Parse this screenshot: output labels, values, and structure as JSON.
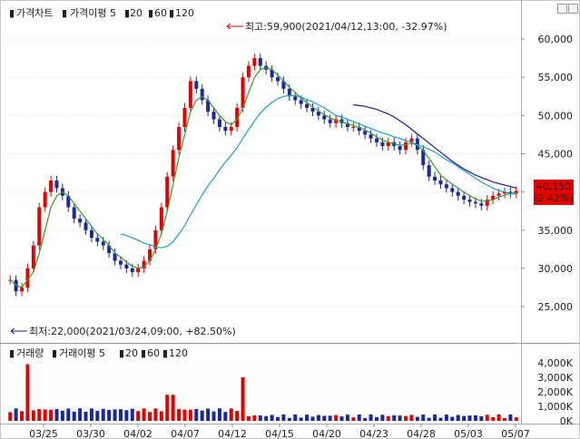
{
  "legend": {
    "price": {
      "marker": "▮",
      "label": "가격차트",
      "color": "#000000"
    },
    "ma_label": "가격이평 5",
    "ma20": "20",
    "ma60": "60",
    "ma120": "120",
    "vol": {
      "label": "거래량"
    },
    "vma_label": "거래이평 5",
    "vma20": "20",
    "vma60": "60",
    "vma120": "120",
    "colors": {
      "ma5": "#3c9a2c",
      "ma20": "#1aa0c8",
      "ma60": "#1a1aa0",
      "ma120": "#8a1a3a"
    }
  },
  "annotations": {
    "high": "최고:59,900(2021/04/12,13:00, -32.97%)",
    "low": "최저:22,000(2021/03/24,09:00, +82.50%)"
  },
  "current": {
    "price": "40,150",
    "change": "(2.42%)",
    "color": "#e60000"
  },
  "y_axis_ticks": [
    "60,000",
    "55,000",
    "50,000",
    "45,000",
    "40,000",
    "35,000",
    "30,000",
    "25,000"
  ],
  "vol_axis_ticks": [
    "4,000K",
    "3,000K",
    "2,000K",
    "1,000K",
    "0K"
  ],
  "x_axis_ticks": [
    "03/25",
    "03/30",
    "04/02",
    "04/07",
    "04/12",
    "04/15",
    "04/20",
    "04/23",
    "04/28",
    "05/03",
    "05/07"
  ],
  "chart_data": {
    "type": "candlestick",
    "ylim": [
      20500,
      62500
    ],
    "x_dates": [
      "03/25",
      "03/30",
      "04/02",
      "04/07",
      "04/12",
      "04/15",
      "04/20",
      "04/23",
      "04/28",
      "05/03",
      "05/07"
    ],
    "close": [
      28500,
      27000,
      27500,
      30000,
      33000,
      38000,
      40000,
      41500,
      40500,
      39500,
      38000,
      36500,
      36000,
      35000,
      34000,
      33500,
      33000,
      32000,
      31000,
      30500,
      30000,
      29500,
      30000,
      31000,
      32500,
      35000,
      38000,
      42000,
      45500,
      48500,
      51000,
      54500,
      53500,
      52000,
      50500,
      49500,
      48500,
      48000,
      48500,
      51000,
      55000,
      56500,
      57500,
      56500,
      56000,
      55000,
      54500,
      53500,
      52500,
      52000,
      51500,
      51000,
      50500,
      50000,
      49500,
      49000,
      49500,
      49000,
      48500,
      48500,
      48000,
      47500,
      47000,
      46500,
      46000,
      46500,
      46000,
      45500,
      46500,
      47000,
      45500,
      43500,
      42000,
      41500,
      41000,
      40500,
      40000,
      39500,
      39000,
      38700,
      38500,
      38200,
      39000,
      39500,
      39800,
      40000,
      39800,
      40150
    ],
    "ma5": [
      28500,
      27800,
      27500,
      28500,
      29500,
      32000,
      35000,
      38000,
      39500,
      40000,
      39500,
      38500,
      37500,
      36500,
      35500,
      34500,
      33800,
      33000,
      32000,
      31500,
      30800,
      30300,
      30000,
      30200,
      31000,
      32500,
      34500,
      37500,
      41000,
      44500,
      47500,
      50500,
      52000,
      52500,
      52000,
      51000,
      50000,
      49200,
      48800,
      49500,
      51000,
      53000,
      55000,
      56000,
      56300,
      56000,
      55300,
      54500,
      53700,
      53000,
      52300,
      51700,
      51100,
      50600,
      50100,
      49700,
      49400,
      49200,
      48900,
      48700,
      48400,
      48100,
      47700,
      47200,
      46800,
      46500,
      46300,
      46100,
      46200,
      46400,
      46100,
      45400,
      44400,
      43300,
      42200,
      41600,
      41000,
      40500,
      40000,
      39500,
      39100,
      38800,
      38800,
      39000,
      39300,
      39600,
      39800,
      39900
    ],
    "ma20": [
      null,
      null,
      null,
      null,
      null,
      null,
      null,
      null,
      null,
      null,
      null,
      null,
      null,
      null,
      null,
      null,
      null,
      null,
      null,
      34500,
      34300,
      34000,
      33700,
      33300,
      33100,
      32800,
      32700,
      32900,
      33500,
      34500,
      35600,
      37000,
      38300,
      39600,
      40800,
      41800,
      42900,
      43900,
      44800,
      45800,
      47000,
      48200,
      49300,
      50300,
      51100,
      51700,
      52200,
      52500,
      52600,
      52600,
      52400,
      52100,
      51800,
      51400,
      51000,
      50500,
      50000,
      49800,
      49500,
      49200,
      48900,
      48600,
      48300,
      48000,
      47700,
      47500,
      47200,
      47000,
      46700,
      46500,
      46200,
      45900,
      45600,
      45200,
      44700,
      44200,
      43800,
      43300,
      42800,
      42300,
      41800,
      41300,
      40900,
      40500,
      40200,
      40000,
      39800,
      39700
    ],
    "ma60": [
      null,
      null,
      null,
      null,
      null,
      null,
      null,
      null,
      null,
      null,
      null,
      null,
      null,
      null,
      null,
      null,
      null,
      null,
      null,
      null,
      null,
      null,
      null,
      null,
      null,
      null,
      null,
      null,
      null,
      null,
      null,
      null,
      null,
      null,
      null,
      null,
      null,
      null,
      null,
      null,
      null,
      null,
      null,
      null,
      null,
      null,
      null,
      null,
      null,
      null,
      null,
      null,
      null,
      null,
      null,
      null,
      null,
      null,
      null,
      51400,
      51300,
      51200,
      51000,
      50800,
      50500,
      50200,
      49800,
      49300,
      48800,
      48200,
      47600,
      47000,
      46400,
      45800,
      45200,
      44600,
      44000,
      43500,
      43000,
      42600,
      42200,
      41900,
      41600,
      41300,
      41100,
      40900,
      40700,
      40500
    ],
    "ma120": []
  }
}
